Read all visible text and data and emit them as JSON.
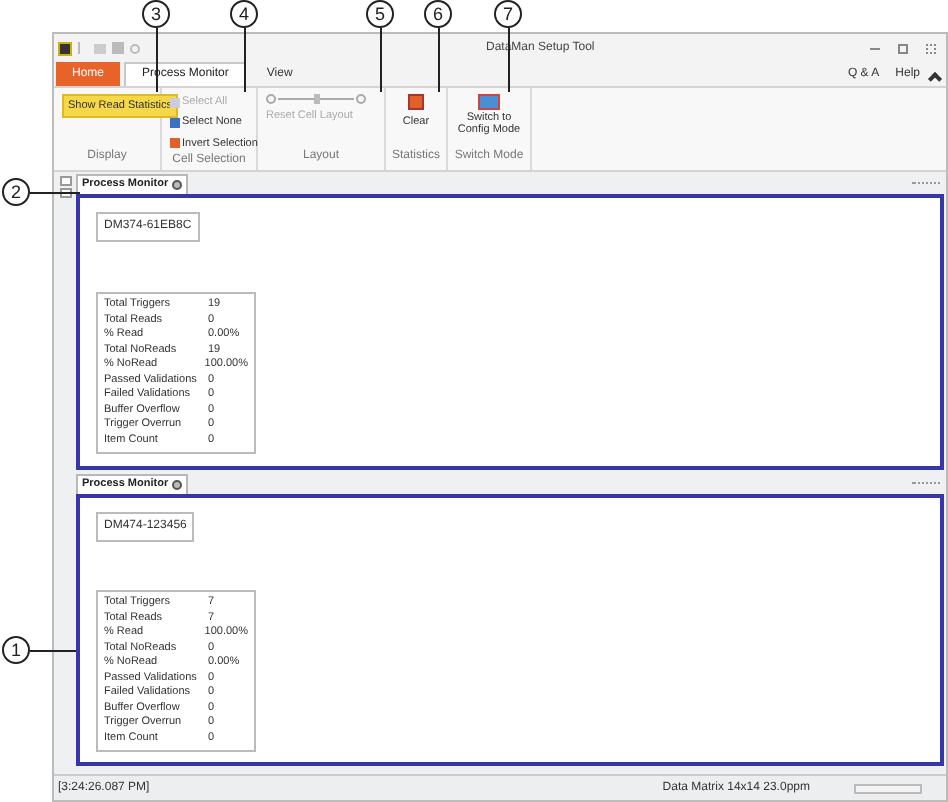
{
  "callouts": [
    "1",
    "2",
    "3",
    "4",
    "5",
    "6",
    "7"
  ],
  "window": {
    "title": "DataMan Setup Tool"
  },
  "ribbon_tabs": [
    {
      "label": "Home",
      "kind": "menu",
      "selected": false
    },
    {
      "label": "Process Monitor",
      "kind": "tab",
      "selected": true
    },
    {
      "label": "View",
      "kind": "tab",
      "selected": false
    }
  ],
  "ribbon_links": [
    "Q & A",
    "Help"
  ],
  "ribbon_groups": {
    "display": {
      "label": "Display",
      "toggle": {
        "label": "Show Read Statistics",
        "on": true
      }
    },
    "cell_selection": {
      "label": "Cell Selection",
      "items": [
        {
          "label": "Select All",
          "disabled": true
        },
        {
          "label": "Select None",
          "disabled": false
        },
        {
          "label": "Invert Selection",
          "disabled": false
        }
      ]
    },
    "layout": {
      "label": "Layout",
      "zoom": {
        "level": 0.5,
        "disabled": true
      },
      "reset": {
        "label": "Reset Cell Layout",
        "disabled": true
      }
    },
    "statistics": {
      "label": "Statistics",
      "button": "Clear"
    },
    "switch_mode": {
      "label": "Switch Mode",
      "button": "Switch to Config Mode"
    }
  },
  "panels": [
    {
      "tab": "Process Monitor",
      "device": "DM374-61EB8C",
      "stats": [
        [
          "Total Triggers",
          "19"
        ],
        [
          "Total Reads",
          "0"
        ],
        [
          "% Read",
          "0.00%"
        ],
        [
          "Total NoReads",
          "19"
        ],
        [
          "% NoRead",
          "100.00%"
        ],
        [
          "Passed Validations",
          "0"
        ],
        [
          "Failed Validations",
          "0"
        ],
        [
          "Buffer Overflow",
          "0"
        ],
        [
          "Trigger Overrun",
          "0"
        ],
        [
          "Item Count",
          "0"
        ]
      ]
    },
    {
      "tab": "Process Monitor",
      "device": "DM474-123456",
      "stats": [
        [
          "Total Triggers",
          "7"
        ],
        [
          "Total Reads",
          "7"
        ],
        [
          "% Read",
          "100.00%"
        ],
        [
          "Total NoReads",
          "0"
        ],
        [
          "% NoRead",
          "0.00%"
        ],
        [
          "Passed Validations",
          "0"
        ],
        [
          "Failed Validations",
          "0"
        ],
        [
          "Buffer Overflow",
          "0"
        ],
        [
          "Trigger Overrun",
          "0"
        ],
        [
          "Item Count",
          "0"
        ]
      ]
    }
  ],
  "status_bar": {
    "time": "[3:24:26.087 PM]",
    "symbology": "Data Matrix 14x14 23.0ppm",
    "progress": {
      "level": 0
    }
  }
}
